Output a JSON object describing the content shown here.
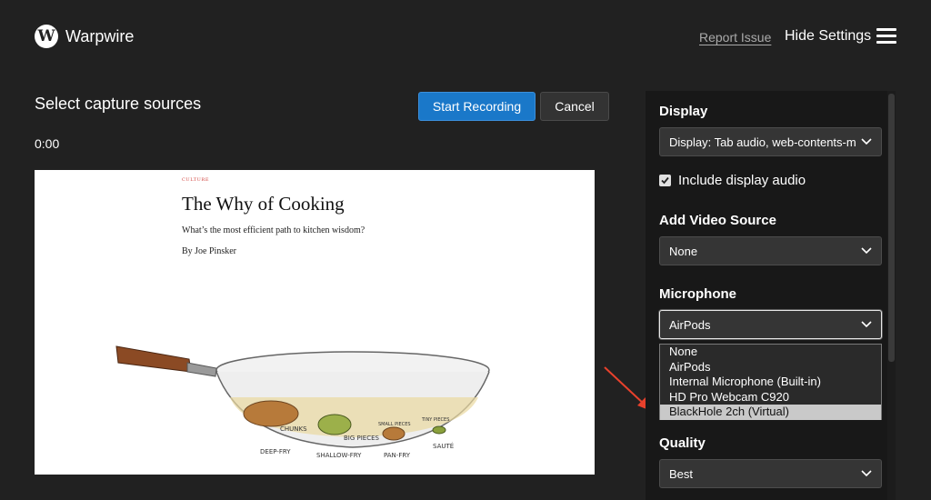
{
  "header": {
    "logo_letter": "W",
    "app_name": "Warpwire",
    "report_issue_label": "Report Issue",
    "hide_settings_label": "Hide Settings"
  },
  "capture": {
    "title": "Select capture sources",
    "timer": "0:00",
    "start_label": "Start Recording",
    "cancel_label": "Cancel"
  },
  "preview": {
    "kicker": "CULTURE",
    "title": "The Why of Cooking",
    "subtitle": "What’s the most efficient path to kitchen wisdom?",
    "byline": "By Joe Pinsker",
    "illustration_labels": [
      "CHUNKS",
      "BIG PIECES",
      "SMALL PIECES",
      "TINY PIECES",
      "DEEP-FRY",
      "SHALLOW-FRY",
      "PAN-FRY",
      "SAUTÉ"
    ]
  },
  "settings": {
    "display": {
      "label": "Display",
      "value": "Display: Tab audio, web-contents-media-stream"
    },
    "include_display_audio": {
      "label": "Include display audio",
      "checked": true
    },
    "video_source": {
      "label": "Add Video Source",
      "value": "None"
    },
    "microphone": {
      "label": "Microphone",
      "value": "AirPods",
      "options": [
        "None",
        "AirPods",
        "Internal Microphone (Built-in)",
        "HD Pro Webcam C920",
        "BlackHole 2ch (Virtual)"
      ],
      "highlighted_index": 4
    },
    "quality": {
      "label": "Quality",
      "value": "Best"
    }
  },
  "colors": {
    "background": "#212121",
    "panel": "#181818",
    "primary_button": "#1a78c9",
    "annotation_arrow": "#e8412c",
    "dropdown_highlight": "#c9c9c9"
  }
}
